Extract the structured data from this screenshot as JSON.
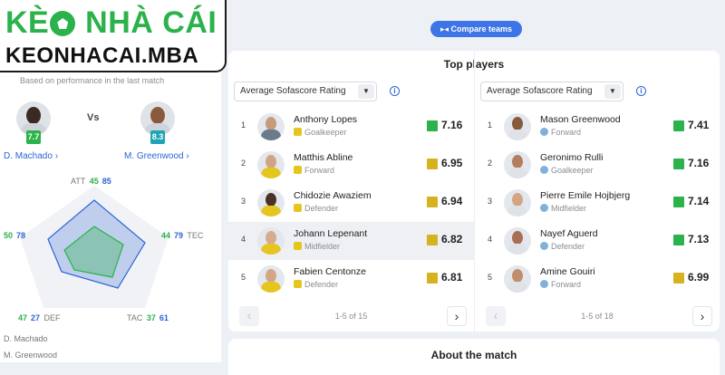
{
  "brand": {
    "line1_a": "KÈ",
    "line1_b": " NHÀ CÁI",
    "line2": "KEONHACAI.MBA"
  },
  "comparison": {
    "performance_note": "Based on performance in the last match",
    "vs_label": "Vs",
    "player_a": {
      "name": "D. Machado",
      "rating": "7.7",
      "rating_color": "#2bb24a"
    },
    "player_b": {
      "name": "M. Greenwood",
      "rating": "8.3",
      "rating_color": "#1ea5b5"
    },
    "stats": {
      "att": {
        "label": "ATT",
        "a": "45",
        "b": "85"
      },
      "tec": {
        "label": "TEC",
        "a": "44",
        "b": "79"
      },
      "tac": {
        "label": "TAC",
        "a": "37",
        "b": "61"
      },
      "def": {
        "label": "DEF",
        "a": "47",
        "b": "27"
      },
      "left": {
        "a": "50",
        "b": "78"
      }
    },
    "legend": [
      "D. Machado",
      "M. Greenwood"
    ],
    "colors": {
      "player_a": "#2bb24a",
      "player_b": "#2c64d6"
    }
  },
  "compare_button": "Compare teams",
  "top_players": {
    "title": "Top players",
    "columns": [
      {
        "dropdown": "Average Sofascore Rating",
        "pager": "1-5 of 15",
        "players": [
          {
            "rank": "1",
            "name": "Anthony Lopes",
            "position": "Goalkeeper",
            "rating": "7.16",
            "color": "#2bb24a",
            "team": "nantes"
          },
          {
            "rank": "2",
            "name": "Matthis Abline",
            "position": "Forward",
            "rating": "6.95",
            "color": "#d6b21f",
            "team": "nantes"
          },
          {
            "rank": "3",
            "name": "Chidozie Awaziem",
            "position": "Defender",
            "rating": "6.94",
            "color": "#d6b21f",
            "team": "nantes"
          },
          {
            "rank": "4",
            "name": "Johann Lepenant",
            "position": "Midfielder",
            "rating": "6.82",
            "color": "#d6b21f",
            "team": "nantes"
          },
          {
            "rank": "5",
            "name": "Fabien Centonze",
            "position": "Defender",
            "rating": "6.81",
            "color": "#d6b21f",
            "team": "nantes"
          }
        ]
      },
      {
        "dropdown": "Average Sofascore Rating",
        "pager": "1-5 of 18",
        "players": [
          {
            "rank": "1",
            "name": "Mason Greenwood",
            "position": "Forward",
            "rating": "7.41",
            "color": "#2bb24a",
            "team": "om"
          },
          {
            "rank": "2",
            "name": "Geronimo Rulli",
            "position": "Goalkeeper",
            "rating": "7.16",
            "color": "#2bb24a",
            "team": "om"
          },
          {
            "rank": "3",
            "name": "Pierre Emile Hojbjerg",
            "position": "Midfielder",
            "rating": "7.14",
            "color": "#2bb24a",
            "team": "om"
          },
          {
            "rank": "4",
            "name": "Nayef Aguerd",
            "position": "Defender",
            "rating": "7.13",
            "color": "#2bb24a",
            "team": "om"
          },
          {
            "rank": "5",
            "name": "Amine Gouiri",
            "position": "Forward",
            "rating": "6.99",
            "color": "#d6b21f",
            "team": "om"
          }
        ]
      }
    ]
  },
  "about": {
    "title": "About the match"
  }
}
